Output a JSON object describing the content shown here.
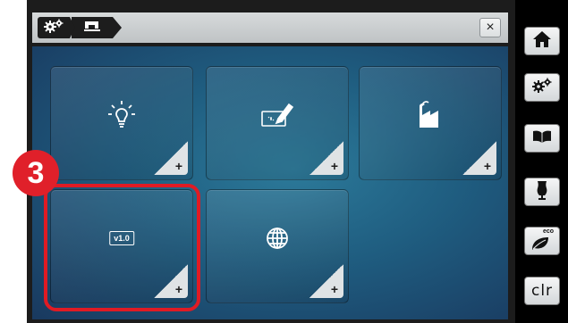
{
  "toolbar": {
    "breadcrumb_icons": [
      "gears-icon",
      "sewing-machine-icon"
    ],
    "close_label": "×"
  },
  "tiles": [
    {
      "icon": "light-bulb-icon",
      "plus": "+"
    },
    {
      "icon": "touchscreen-calibration-icon",
      "plus": "+"
    },
    {
      "icon": "factory-icon",
      "plus": "+"
    },
    {
      "icon": "version-icon",
      "version_text": "v1.0",
      "plus": "+"
    },
    {
      "icon": "globe-icon",
      "plus": "+"
    }
  ],
  "annotation": {
    "step_number": "3",
    "color": "#e01b24"
  },
  "sidebar": {
    "items": [
      "home-icon",
      "settings-icon",
      "book-icon",
      "dress-form-icon",
      "eco-icon"
    ],
    "eco_label": "eco",
    "clr_label": "clr"
  },
  "colors": {
    "accent_red": "#e01b24",
    "background_blue": "#1f5d80"
  }
}
